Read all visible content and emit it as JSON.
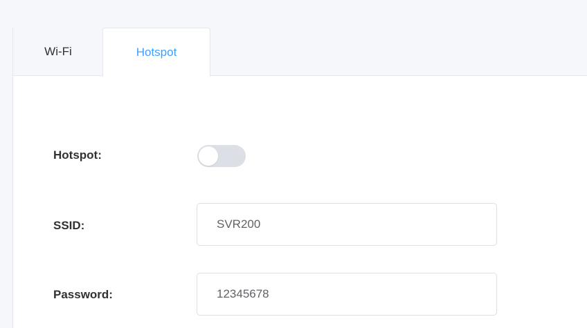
{
  "tabs": [
    {
      "label": "Wi-Fi",
      "active": false
    },
    {
      "label": "Hotspot",
      "active": true
    }
  ],
  "form": {
    "hotspot_label": "Hotspot:",
    "hotspot_enabled": false,
    "ssid_label": "SSID:",
    "ssid_value": "SVR200",
    "password_label": "Password:",
    "password_value": "12345678"
  },
  "colors": {
    "accent": "#409eff",
    "background": "#f5f7fa",
    "border": "#dcdfe6",
    "switch_off": "#dcdfe6"
  }
}
